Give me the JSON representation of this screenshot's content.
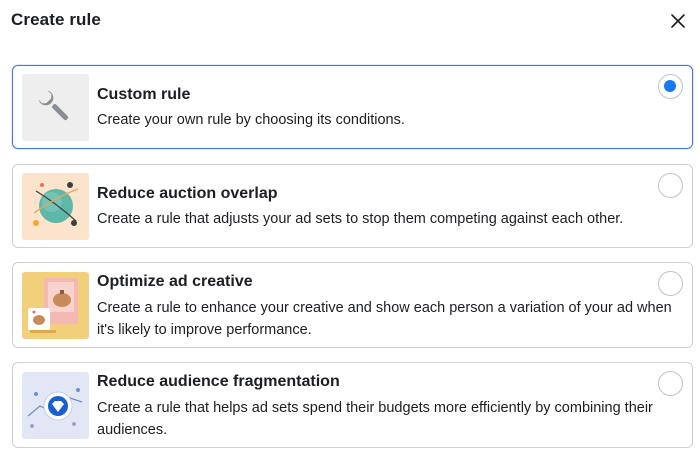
{
  "dialog": {
    "title": "Create rule",
    "close_icon": "close-icon"
  },
  "options": [
    {
      "title": "Custom rule",
      "description": "Create your own rule by choosing its conditions.",
      "icon": "wrench-icon",
      "selected": true
    },
    {
      "title": "Reduce auction overlap",
      "description": "Create a rule that adjusts your ad sets to stop them competing against each other.",
      "icon": "auction-overlap-illustration",
      "selected": false
    },
    {
      "title": "Optimize ad creative",
      "description": "Create a rule to enhance your creative and show each person a variation of your ad when it's likely to improve performance.",
      "icon": "ad-creative-illustration",
      "selected": false
    },
    {
      "title": "Reduce audience fragmentation",
      "description": "Create a rule that helps ad sets spend their budgets more efficiently by combining their audiences.",
      "icon": "audience-fragmentation-illustration",
      "selected": false
    }
  ],
  "colors": {
    "accent": "#1877f2",
    "selected_border": "#4a74d8",
    "border": "#ccd0d5"
  }
}
